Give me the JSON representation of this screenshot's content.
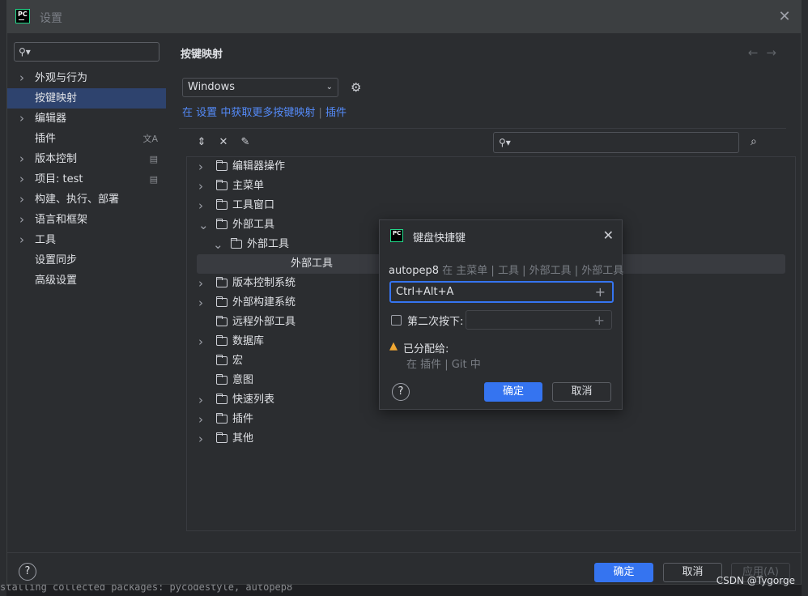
{
  "window": {
    "title": "设置",
    "app_logo": "PC"
  },
  "sidebar": {
    "search_placeholder": "",
    "items": [
      {
        "label": "外观与行为",
        "expandable": true
      },
      {
        "label": "按键映射",
        "expandable": false,
        "active": true
      },
      {
        "label": "编辑器",
        "expandable": true
      },
      {
        "label": "插件",
        "expandable": false,
        "icon": "translate-icon"
      },
      {
        "label": "版本控制",
        "expandable": true,
        "icon": "project-icon"
      },
      {
        "label": "项目: test",
        "expandable": true,
        "icon": "project-icon"
      },
      {
        "label": "构建、执行、部署",
        "expandable": true
      },
      {
        "label": "语言和框架",
        "expandable": true
      },
      {
        "label": "工具",
        "expandable": true
      },
      {
        "label": "设置同步",
        "expandable": false
      },
      {
        "label": "高级设置",
        "expandable": false
      }
    ]
  },
  "main": {
    "title": "按键映射",
    "keymap_value": "Windows",
    "link_prefix": "在",
    "link_settings": "设置",
    "link_middle": "中获取更多按键映射",
    "link_sep": "|",
    "link_plugins": "插件",
    "tree": [
      {
        "label": "编辑器操作",
        "level": 0,
        "chevron": "right",
        "folder": true
      },
      {
        "label": "主菜单",
        "level": 0,
        "chevron": "right",
        "folder": true
      },
      {
        "label": "工具窗口",
        "level": 0,
        "chevron": "right",
        "folder": true
      },
      {
        "label": "外部工具",
        "level": 0,
        "chevron": "down",
        "folder": true
      },
      {
        "label": "外部工具",
        "level": 1,
        "chevron": "down",
        "folder": true
      },
      {
        "label": "外部工具",
        "level": 2,
        "chevron": "",
        "folder": false,
        "selected": true
      },
      {
        "label": "版本控制系统",
        "level": 0,
        "chevron": "right",
        "folder": true
      },
      {
        "label": "外部构建系统",
        "level": 0,
        "chevron": "right",
        "folder": true
      },
      {
        "label": "远程外部工具",
        "level": 0,
        "chevron": "",
        "folder": true
      },
      {
        "label": "数据库",
        "level": 0,
        "chevron": "right",
        "folder": true
      },
      {
        "label": "宏",
        "level": 0,
        "chevron": "",
        "folder": true
      },
      {
        "label": "意图",
        "level": 0,
        "chevron": "",
        "folder": true
      },
      {
        "label": "快速列表",
        "level": 0,
        "chevron": "right",
        "folder": true
      },
      {
        "label": "插件",
        "level": 0,
        "chevron": "right",
        "folder": true
      },
      {
        "label": "其他",
        "level": 0,
        "chevron": "right",
        "folder": true
      }
    ]
  },
  "dialog": {
    "title": "键盘快捷键",
    "action_name": "autopep8",
    "action_path": "在 主菜单 | 工具 | 外部工具 | 外部工具",
    "shortcut_value": "Ctrl+Alt+A",
    "second_stroke_label": "第二次按下:",
    "assigned_label": "已分配给:",
    "assigned_where": "在 插件 | Git 中",
    "ok_label": "确定",
    "cancel_label": "取消"
  },
  "footer": {
    "ok_label": "确定",
    "cancel_label": "取消",
    "apply_label": "应用(A)",
    "watermark": "CSDN @Tygorge"
  },
  "background": {
    "bottom_text": "stalling collected packages: pycodestyle, autopep8"
  },
  "colors": {
    "accent": "#3574f0",
    "link": "#548af7",
    "warning": "#f0a732",
    "selection": "#2e436e"
  }
}
